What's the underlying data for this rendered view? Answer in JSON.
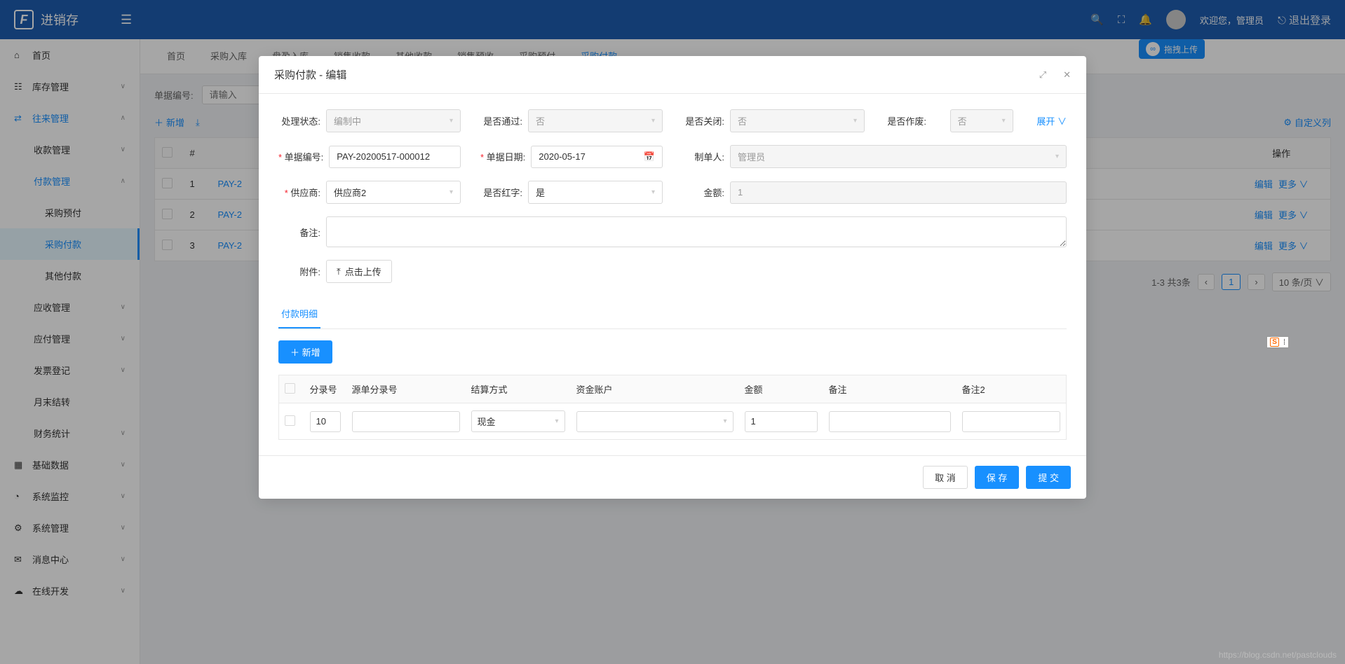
{
  "brand": "进销存",
  "header": {
    "welcome": "欢迎您，管理员",
    "logout": "退出登录",
    "upload_badge": "拖拽上传"
  },
  "sidebar": [
    {
      "icon": "⌂",
      "label": "首页",
      "kind": "item"
    },
    {
      "icon": "☷",
      "label": "库存管理",
      "kind": "collapse",
      "arrow": "∨"
    },
    {
      "icon": "⇄",
      "label": "往来管理",
      "kind": "collapse",
      "arrow": "∧",
      "open": true,
      "active": true
    },
    {
      "label": "收款管理",
      "kind": "child",
      "arrow": "∨"
    },
    {
      "label": "付款管理",
      "kind": "child",
      "arrow": "∧",
      "open": true,
      "active": true
    },
    {
      "label": "采购预付",
      "kind": "grandchild"
    },
    {
      "label": "采购付款",
      "kind": "grandchild",
      "active": true
    },
    {
      "label": "其他付款",
      "kind": "grandchild"
    },
    {
      "label": "应收管理",
      "kind": "child",
      "arrow": "∨"
    },
    {
      "label": "应付管理",
      "kind": "child",
      "arrow": "∨"
    },
    {
      "label": "发票登记",
      "kind": "child",
      "arrow": "∨"
    },
    {
      "label": "月末结转",
      "kind": "child"
    },
    {
      "label": "财务统计",
      "kind": "child",
      "arrow": "∨"
    },
    {
      "icon": "▦",
      "label": "基础数据",
      "kind": "collapse",
      "arrow": "∨"
    },
    {
      "icon": "◔",
      "label": "系统监控",
      "kind": "collapse",
      "arrow": "∨"
    },
    {
      "icon": "⚙",
      "label": "系统管理",
      "kind": "collapse",
      "arrow": "∨"
    },
    {
      "icon": "✉",
      "label": "消息中心",
      "kind": "collapse",
      "arrow": "∨"
    },
    {
      "icon": "☁",
      "label": "在线开发",
      "kind": "collapse",
      "arrow": "∨"
    }
  ],
  "tabs": [
    "首页",
    "采购入库",
    "盘盈入库",
    "销售收款",
    "其他收款",
    "销售预收",
    "采购预付",
    "采购付款"
  ],
  "active_tab": "采购付款",
  "filter": {
    "label": "单据编号:",
    "placeholder": "请输入"
  },
  "toolbar": {
    "add": "新增",
    "custom_cols": "自定义列"
  },
  "table": {
    "headers": {
      "num": "#",
      "ops": "操作"
    },
    "rows": [
      {
        "n": "1",
        "code": "PAY-2",
        "edit": "编辑",
        "more": "更多"
      },
      {
        "n": "2",
        "code": "PAY-2",
        "edit": "编辑",
        "more": "更多"
      },
      {
        "n": "3",
        "code": "PAY-2",
        "edit": "编辑",
        "more": "更多"
      }
    ]
  },
  "pagination": {
    "summary": "1-3 共3条",
    "page": "1",
    "size": "10 条/页"
  },
  "modal": {
    "title": "采购付款 - 编辑",
    "expand": "展开",
    "fields": {
      "status": {
        "label": "处理状态:",
        "value": "编制中"
      },
      "passed": {
        "label": "是否通过:",
        "value": "否"
      },
      "closed": {
        "label": "是否关闭:",
        "value": "否"
      },
      "voided": {
        "label": "是否作废:",
        "value": "否"
      },
      "code": {
        "label": "单据编号:",
        "value": "PAY-20200517-000012"
      },
      "date": {
        "label": "单据日期:",
        "value": "2020-05-17"
      },
      "creator": {
        "label": "制单人:",
        "value": "管理员"
      },
      "supplier": {
        "label": "供应商:",
        "value": "供应商2"
      },
      "is_red": {
        "label": "是否红字:",
        "value": "是"
      },
      "amount": {
        "label": "金额:",
        "value": "1"
      },
      "remark": {
        "label": "备注:"
      },
      "attach": {
        "label": "附件:",
        "btn": "点击上传"
      }
    },
    "sub_tab": "付款明细",
    "detail_add": "新增",
    "detail_headers": {
      "entry": "分录号",
      "src": "源单分录号",
      "settle": "结算方式",
      "account": "资金账户",
      "amount": "金额",
      "remark": "备注",
      "remark2": "备注2"
    },
    "detail_row": {
      "entry": "10",
      "settle": "现金",
      "amount": "1"
    },
    "footer": {
      "cancel": "取 消",
      "save": "保 存",
      "submit": "提 交"
    }
  },
  "watermark": "https://blog.csdn.net/pastclouds"
}
